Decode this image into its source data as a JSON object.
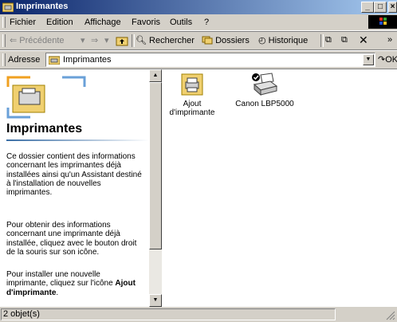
{
  "window": {
    "title": "Imprimantes"
  },
  "menu": [
    "Fichier",
    "Edition",
    "Affichage",
    "Favoris",
    "Outils",
    "?"
  ],
  "toolbar": {
    "back": "Précédente",
    "search": "Rechercher",
    "folders": "Dossiers",
    "history": "Historique"
  },
  "address": {
    "label": "Adresse",
    "value": "Imprimantes",
    "go": "OK"
  },
  "left_pane": {
    "title": "Imprimantes",
    "p1": "Ce dossier contient des informations concernant les imprimantes déjà installées ainsi qu'un Assistant destiné à l'installation de nouvelles imprimantes.",
    "p2": "Pour obtenir des informations concernant une imprimante déjà installée, cliquez avec le bouton droit de la souris sur son icône.",
    "p3_prefix": "Pour installer une nouvelle imprimante, cliquez sur l'icône",
    "p3_bold": "Ajout d'imprimante",
    "p3_suffix": "."
  },
  "items": [
    {
      "label": "Ajout d'imprimante",
      "icon": "add-printer-icon"
    },
    {
      "label": "Canon LBP5000",
      "icon": "printer-icon"
    }
  ],
  "status": {
    "text": "2 objet(s)"
  },
  "colors": {
    "title_start": "#0a246a",
    "title_end": "#a6caf0",
    "face": "#d4d0c8"
  }
}
